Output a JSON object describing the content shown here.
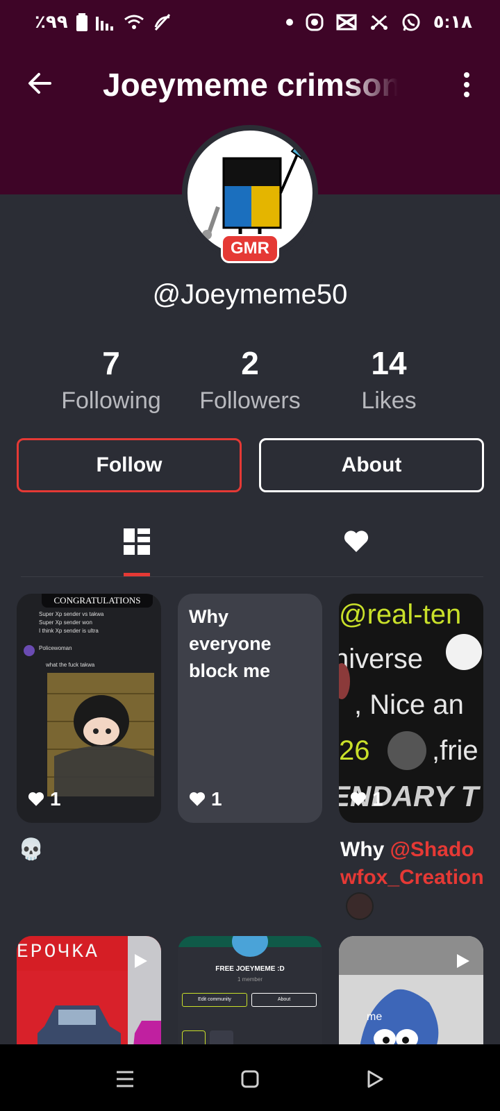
{
  "status_bar": {
    "battery": "٪۹۹",
    "time": "٥:١٨"
  },
  "header": {
    "title": "Joeymeme crimson"
  },
  "profile": {
    "badge": "GMR",
    "handle": "@Joeymeme50"
  },
  "stats": [
    {
      "value": "7",
      "label": "Following"
    },
    {
      "value": "2",
      "label": "Followers"
    },
    {
      "value": "14",
      "label": "Likes"
    }
  ],
  "buttons": {
    "follow": "Follow",
    "about": "About"
  },
  "posts": {
    "p1": {
      "likes": "1",
      "banner": "CONGRATULATIONS",
      "lines": [
        "Super Xp sender vs takwa",
        "Super Xp sender won",
        "I think Xp sender is ultra"
      ],
      "author": "Policewoman",
      "fwd": "what the fuck takwa",
      "caption": "💀"
    },
    "p2": {
      "likes": "1",
      "text": "Why everyone block me"
    },
    "p3": {
      "likes": "1",
      "lines": [
        "@real-ten",
        "niverse",
        ", Nice an",
        "26",
        ",frie",
        "ENDARY T"
      ],
      "caption_prefix": "Why ",
      "caption_mention": "@Shadowfox_Creation"
    },
    "p4": {
      "overlay": "EPOЧKA"
    },
    "p5": {
      "community": "FREE JOEYMEME :D",
      "members": "1 member",
      "edit": "Edit community",
      "about": "About"
    },
    "p6": {
      "label": "me"
    }
  },
  "colors": {
    "header_bg": "#3e0527",
    "page_bg": "#2b2d35",
    "accent": "#e53935"
  }
}
